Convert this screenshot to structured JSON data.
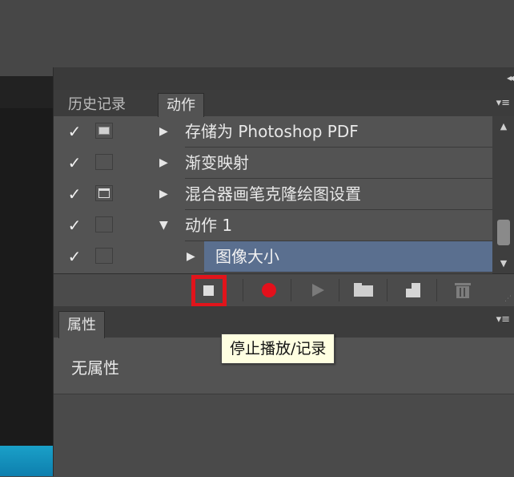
{
  "actions_panel": {
    "tabs": [
      {
        "label": "历史记录",
        "active": false
      },
      {
        "label": "动作",
        "active": true
      }
    ],
    "rows": [
      {
        "checked": true,
        "dialog_toggle": "on",
        "expand": "▶",
        "label": "存储为 Photoshop PDF"
      },
      {
        "checked": true,
        "dialog_toggle": "off",
        "expand": "▶",
        "label": "渐变映射"
      },
      {
        "checked": true,
        "dialog_toggle": "on2",
        "expand": "▶",
        "label": "混合器画笔克隆绘图设置"
      },
      {
        "checked": true,
        "dialog_toggle": "off",
        "expand": "▼",
        "label": "动作 1"
      },
      {
        "checked": true,
        "dialog_toggle": "off",
        "expand": "▶",
        "label": "图像大小",
        "selected": true
      }
    ],
    "check_glyph": "✓",
    "toolbar": {
      "buttons": [
        "stop-icon",
        "record-icon",
        "play-icon",
        "new-set-icon",
        "new-action-icon",
        "trash-icon"
      ]
    },
    "collapse_glyph": "◂◂",
    "menu_glyph": "▾≡"
  },
  "properties_panel": {
    "tab_label": "属性",
    "content_text": "无属性",
    "menu_glyph": "▾≡"
  },
  "tooltip": {
    "text": "停止播放/记录"
  },
  "colors": {
    "record_red": "#e3101b",
    "highlight_red": "#e1141b",
    "selection_blue": "#5a6f8f",
    "tooltip_bg": "#ffffe1"
  },
  "scrollbar": {
    "up": "▲",
    "down": "▼"
  }
}
